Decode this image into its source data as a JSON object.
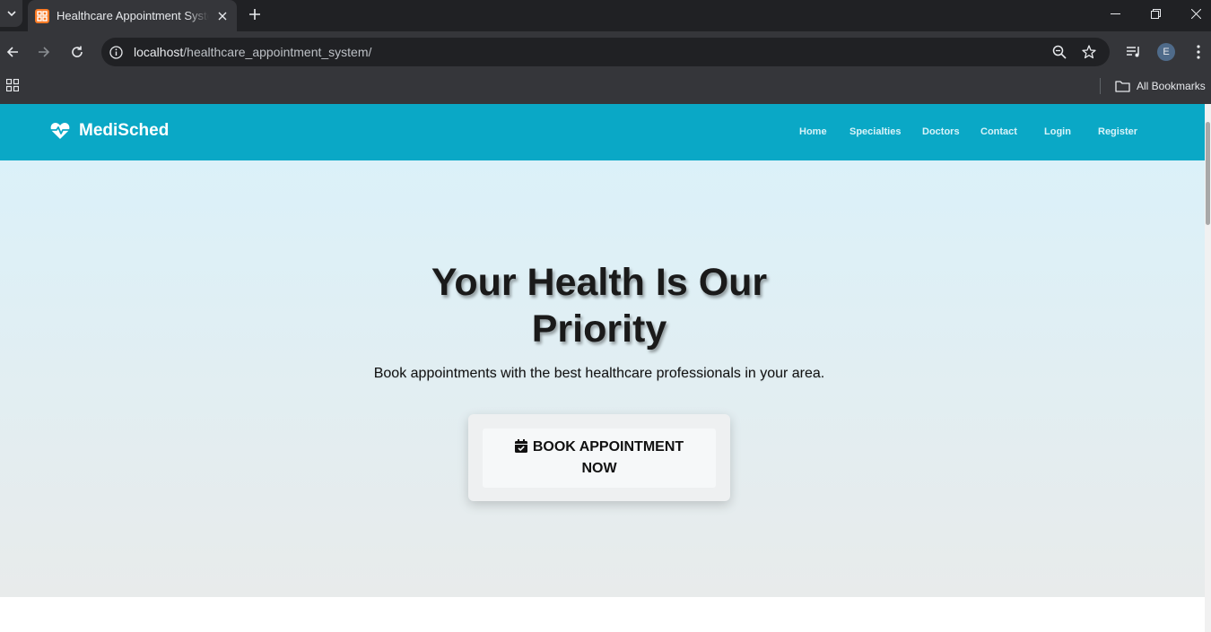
{
  "browser": {
    "tab_title": "Healthcare Appointment System",
    "favicon_label": "⊞",
    "url_host": "localhost",
    "url_path": "/healthcare_appointment_system/",
    "profile_initial": "E",
    "bookmarks_label": "All Bookmarks"
  },
  "site": {
    "brand": "MediSched",
    "nav": [
      "Home",
      "Specialties",
      "Doctors",
      "Contact",
      "Login",
      "Register"
    ]
  },
  "hero": {
    "title_line1": "Your Health Is Our",
    "title_line2": "Priority",
    "subtitle": "Book appointments with the best healthcare professionals in your area.",
    "cta_label": "BOOK APPOINTMENT NOW"
  },
  "colors": {
    "nav_bg": "#0aa8c6",
    "hero_top": "#dbf1f9",
    "hero_bottom": "#e8ebeb"
  }
}
